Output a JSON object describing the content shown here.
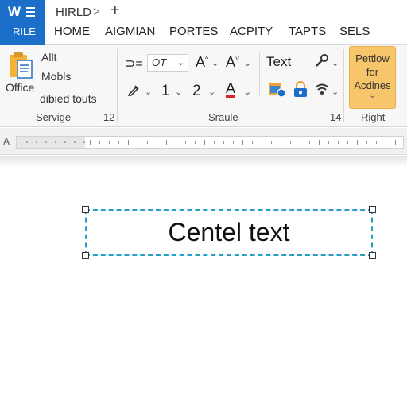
{
  "app": {
    "logo_text": "W",
    "file_label": "RILE"
  },
  "title_bar": {
    "doc_title": "HIRLD",
    "chevron": ">",
    "new_tab": "+"
  },
  "tabs": [
    "HOME",
    "AIGMIAN",
    "PORTES",
    "ACPITY",
    "TAPTS",
    "SELS"
  ],
  "ribbon": {
    "office_group": {
      "office_label": "Office",
      "commands": [
        "Allt",
        "Mobls",
        "dibied touts"
      ],
      "group_label": "Servige",
      "group_number": "12"
    },
    "font_group": {
      "font_combo_value": "OT",
      "grow_label": "A",
      "shrink_label": "A",
      "number_one": "1",
      "number_two": "2",
      "font_color_label": "A",
      "text_label": "Text",
      "group_label": "Sraule",
      "group_number": "14"
    },
    "right_group": {
      "button_lines": [
        "Pettlow",
        "for",
        "Acdines"
      ],
      "group_label": "Right"
    }
  },
  "ruler": {
    "left_marker": "A"
  },
  "document": {
    "textbox_text": "Centel text"
  },
  "colors": {
    "file_tab": "#1b6fc9",
    "highlight_button": "#f7c66a",
    "textbox_border": "#27a0c9",
    "font_color_underline": "#d9262c"
  }
}
